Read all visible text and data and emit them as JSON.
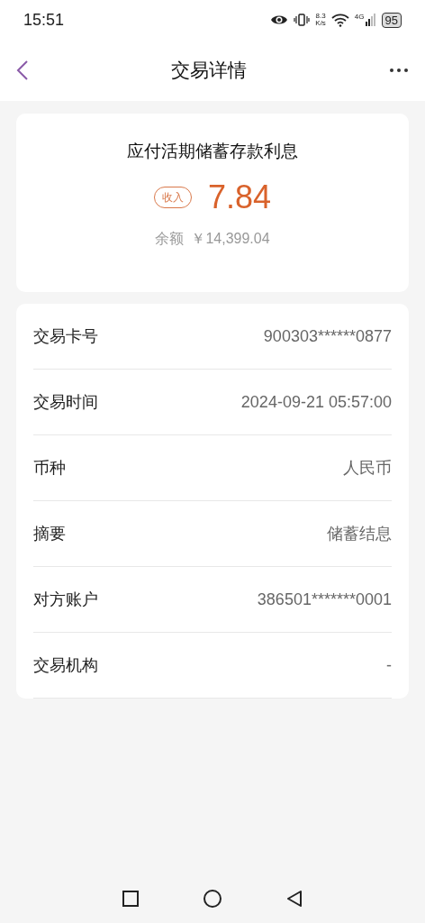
{
  "status_bar": {
    "time": "15:51",
    "net_speed": [
      "8.3",
      "K/s"
    ],
    "network": "4G",
    "battery": "95"
  },
  "header": {
    "title": "交易详情"
  },
  "summary": {
    "title": "应付活期储蓄存款利息",
    "direction": "收入",
    "amount": "7.84",
    "balance_label": "余额",
    "balance": "￥14,399.04"
  },
  "details": [
    {
      "label": "交易卡号",
      "value": "900303******0877"
    },
    {
      "label": "交易时间",
      "value": "2024-09-21 05:57:00"
    },
    {
      "label": "币种",
      "value": "人民币"
    },
    {
      "label": "摘要",
      "value": "储蓄结息"
    },
    {
      "label": "对方账户",
      "value": "386501*******0001"
    },
    {
      "label": "交易机构",
      "value": "-"
    }
  ]
}
